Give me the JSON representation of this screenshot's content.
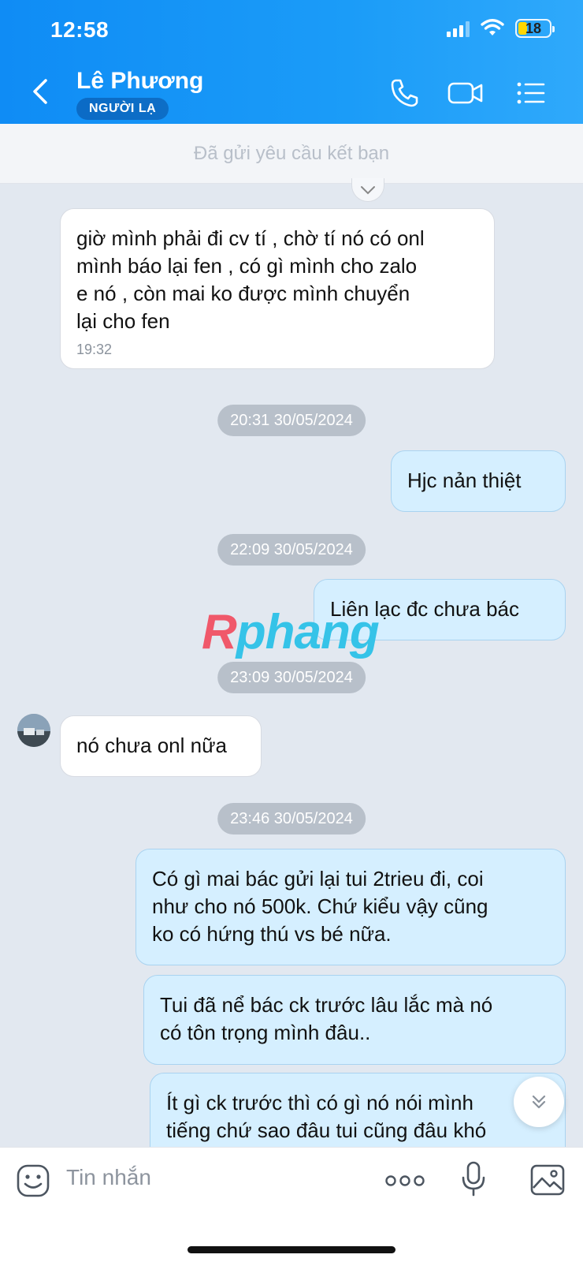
{
  "status_bar": {
    "time": "12:58",
    "battery": "18"
  },
  "header": {
    "contact_name": "Lê Phương",
    "badge": "NGƯỜI LẠ",
    "icons": [
      "back-arrow-icon",
      "phone-icon",
      "video-call-icon",
      "menu-list-icon"
    ]
  },
  "banner": {
    "text": "Đã gửi yêu cầu kết bạn"
  },
  "messages": [
    {
      "type": "incoming",
      "lines": [
        "giờ mình phải đi cv tí , chờ tí nó có onl",
        "mình báo lại fen , có gì mình cho zalo",
        "e nó , còn mai ko được mình chuyển",
        "lại cho fen"
      ],
      "time": "19:32"
    },
    {
      "type": "timestamp",
      "text": "20:31 30/05/2024"
    },
    {
      "type": "outgoing",
      "lines": [
        "Hjc nản thiệt"
      ]
    },
    {
      "type": "timestamp",
      "text": "22:09 30/05/2024"
    },
    {
      "type": "outgoing",
      "lines": [
        "Liên lạc đc chưa bác"
      ]
    },
    {
      "type": "timestamp",
      "text": "23:09 30/05/2024"
    },
    {
      "type": "incoming",
      "lines": [
        "nó chưa onl nữa"
      ]
    },
    {
      "type": "timestamp",
      "text": "23:46 30/05/2024"
    },
    {
      "type": "outgoing",
      "lines": [
        "Có gì mai bác gửi lại tui 2trieu đi, coi",
        "như cho nó 500k. Chứ kiểu vậy cũng",
        "ko có hứng thú vs bé nữa."
      ]
    },
    {
      "type": "outgoing",
      "lines": [
        "Tui đã nể bác ck trước lâu lắc mà nó",
        "có tôn trọng mình đâu.."
      ]
    },
    {
      "type": "outgoing",
      "lines": [
        "Ít gì ck trước thì có gì nó nói mình",
        "tiếng chứ sao đâu tui cũng đâu khó"
      ]
    }
  ],
  "watermark": {
    "first": "R",
    "rest": "phang"
  },
  "input_bar": {
    "placeholder": "Tin nhắn"
  },
  "colors": {
    "header": "#1b9cf8",
    "outgoing_bubble": "#d5efff",
    "incoming_bubble": "#ffffff",
    "background": "#e2e8f0"
  }
}
